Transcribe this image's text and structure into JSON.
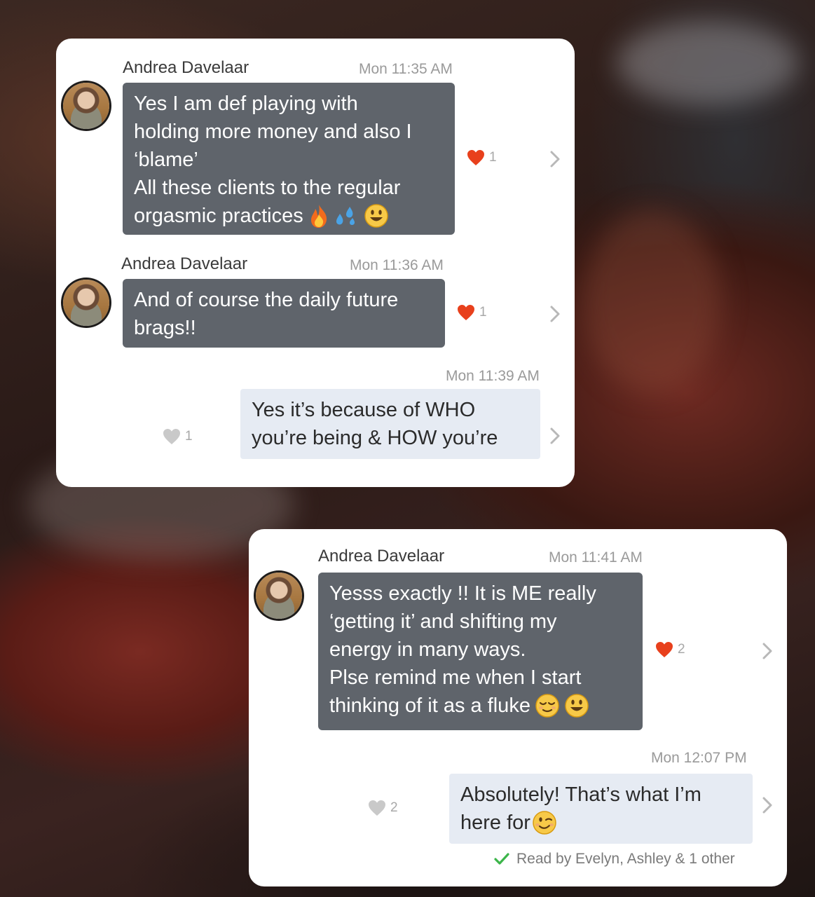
{
  "colors": {
    "incoming_bubble": "#5f646b",
    "outgoing_bubble": "#e6ebf3",
    "heart_active": "#e8401c",
    "heart_inactive": "#c9c9c9",
    "check": "#3cb54a"
  },
  "card1": {
    "messages": [
      {
        "sender": "Andrea Davelaar",
        "time": "Mon 11:35 AM",
        "lines": [
          "Yes I am def playing with",
          "holding more money and also I",
          "‘blame’",
          "All these clients to the regular",
          "orgasmic practices"
        ],
        "emojis": [
          "fire-icon",
          "sweat-droplets-icon",
          "smiley-icon"
        ],
        "likes": "1"
      },
      {
        "sender": "Andrea Davelaar",
        "time": "Mon 11:36 AM",
        "lines": [
          "And of course the daily future",
          "brags!!"
        ],
        "likes": "1"
      },
      {
        "time": "Mon 11:39 AM",
        "lines": [
          "Yes it’s because of WHO",
          "you’re being & HOW you’re"
        ],
        "likes": "1"
      }
    ]
  },
  "card2": {
    "messages": [
      {
        "sender": "Andrea Davelaar",
        "time": "Mon 11:41 AM",
        "lines": [
          "Yesss exactly !! It is ME really",
          "‘getting it’ and shifting my",
          "energy in many ways.",
          "Plse remind me when I start",
          "thinking of it as a fluke"
        ],
        "emojis": [
          "relieved-face-icon",
          "smiley-icon"
        ],
        "likes": "2"
      },
      {
        "time": "Mon 12:07 PM",
        "lines": [
          "Absolutely! That’s what I’m",
          "here for"
        ],
        "emojis": [
          "winking-face-icon"
        ],
        "likes": "2"
      }
    ],
    "read_receipt": "Read by Evelyn, Ashley & 1 other"
  }
}
